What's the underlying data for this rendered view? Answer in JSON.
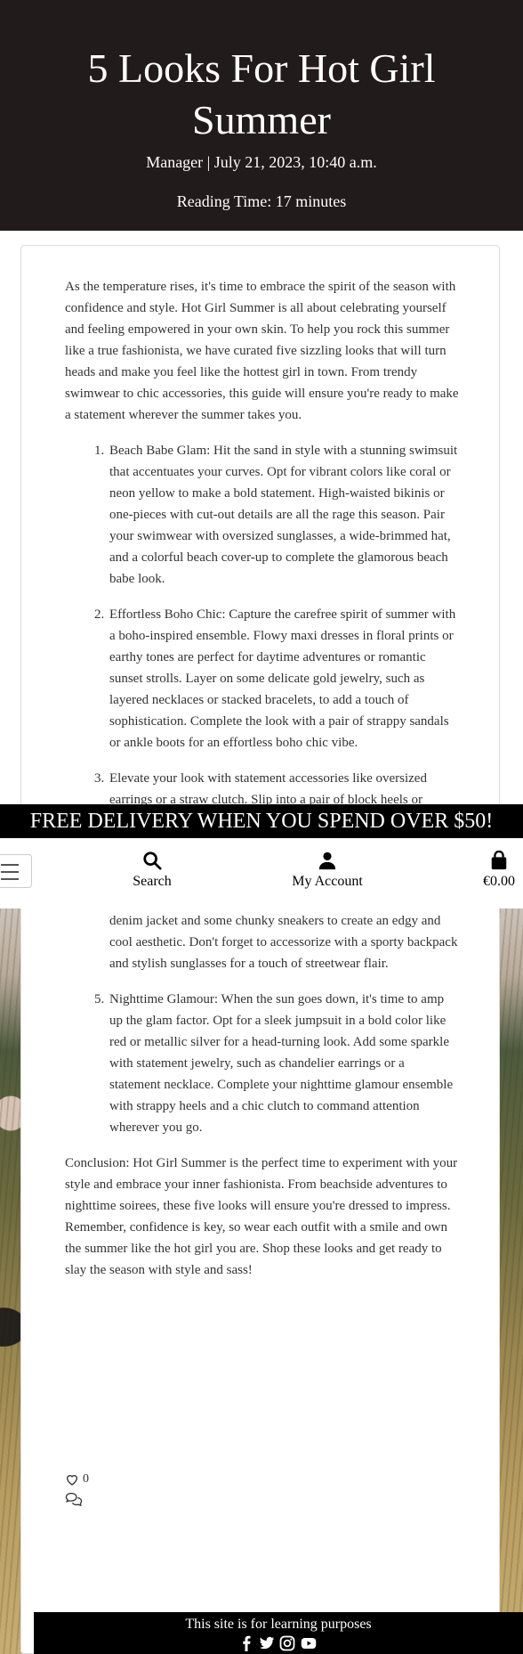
{
  "hero": {
    "title": "5 Looks For Hot Girl Summer",
    "meta": "Manager | July 21, 2023, 10:40 a.m.",
    "reading_time": "Reading Time: 17 minutes"
  },
  "article": {
    "intro": "As the temperature rises, it's time to embrace the spirit of the season with confidence and style. Hot Girl Summer is all about celebrating yourself and feeling empowered in your own skin. To help you rock this summer like a true fashionista, we have curated five sizzling looks that will turn heads and make you feel like the hottest girl in town. From trendy swimwear to chic accessories, this guide will ensure you're ready to make a statement wherever the summer takes you.",
    "looks": [
      "Beach Babe Glam: Hit the sand in style with a stunning swimsuit that accentuates your curves. Opt for vibrant colors like coral or neon yellow to make a bold statement. High-waisted bikinis or one-pieces with cut-out details are all the rage this season. Pair your swimwear with oversized sunglasses, a wide-brimmed hat, and a colorful beach cover-up to complete the glamorous beach babe look.",
      "Effortless Boho Chic: Capture the carefree spirit of summer with a boho-inspired ensemble. Flowy maxi dresses in floral prints or earthy tones are perfect for daytime adventures or romantic sunset strolls. Layer on some delicate gold jewelry, such as layered necklaces or stacked bracelets, to add a touch of sophistication. Complete the look with a pair of strappy sandals or ankle boots for an effortless boho chic vibe.",
      "Elevate your look with statement accessories like oversized earrings or a straw clutch. Slip into a pair of block heels or wedges for added elegance and comfort.",
      "Sporty Spice: Channel your inner sporty diva with a stylish athleisure outfit. Pair high-waisted biker shorts or leggings with a cropped tank top or a trendy sports bra. Throw on an oversized denim jacket and some chunky sneakers to create an edgy and cool aesthetic. Don't forget to accessorize with a sporty backpack and stylish sunglasses for a touch of streetwear flair.",
      "Nighttime Glamour: When the sun goes down, it's time to amp up the glam factor. Opt for a sleek jumpsuit in a bold color like red or metallic silver for a head-turning look. Add some sparkle with statement jewelry, such as chandelier earrings or a statement necklace. Complete your nighttime glamour ensemble with strappy heels and a chic clutch to command attention wherever you go."
    ],
    "conclusion": "Conclusion: Hot Girl Summer is the perfect time to experiment with your style and embrace your inner fashionista. From beachside adventures to nighttime soirees, these five looks will ensure you're dressed to impress. Remember, confidence is key, so wear each outfit with a smile and own the summer like the hot girl you are. Shop these looks and get ready to slay the season with style and sass!",
    "like_count": "0"
  },
  "banner": {
    "text": "FREE DELIVERY WHEN YOU SPEND OVER $50!"
  },
  "nav": {
    "search_label": "Search",
    "account_label": "My Account",
    "cart_total": "€0.00",
    "icons": [
      "menu-icon",
      "search-icon",
      "user-icon",
      "shopping-bag-icon"
    ]
  },
  "footer": {
    "text": "This site is for learning purposes",
    "social_icons": [
      "facebook-icon",
      "twitter-icon",
      "instagram-icon",
      "youtube-icon"
    ]
  }
}
